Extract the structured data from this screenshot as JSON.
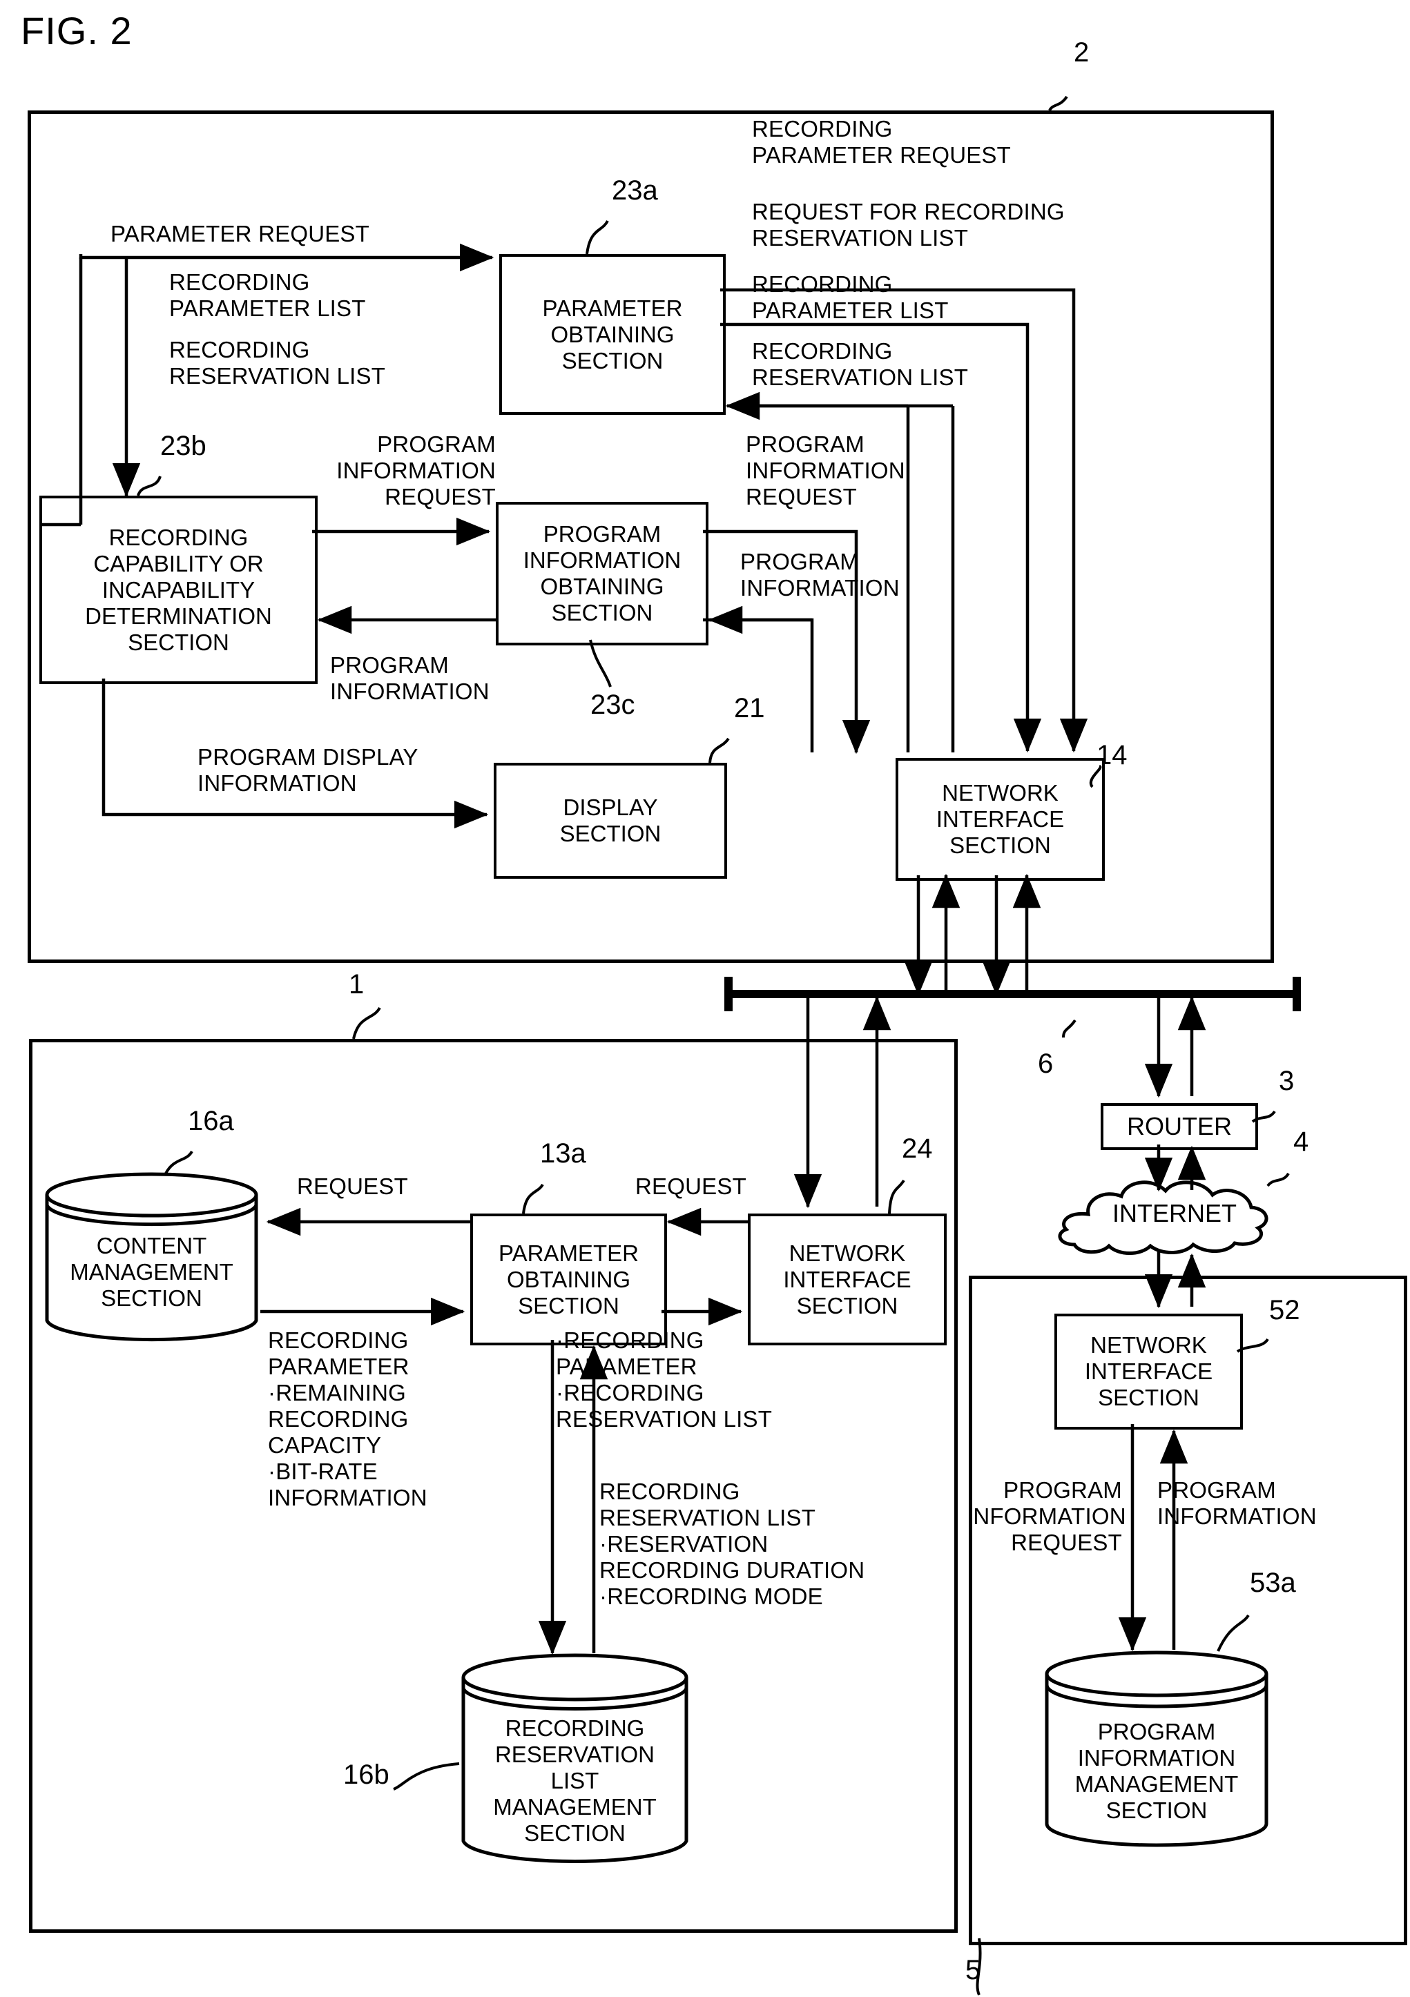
{
  "figure": {
    "title": "FIG. 2"
  },
  "refs": {
    "r2": "2",
    "r1": "1",
    "r6": "6",
    "r3": "3",
    "r4": "4",
    "r5": "5",
    "r14": "14",
    "r21": "21",
    "r23a": "23a",
    "r23b": "23b",
    "r23c": "23c",
    "r24": "24",
    "r13a": "13a",
    "r16a": "16a",
    "r16b": "16b",
    "r52": "52",
    "r53a": "53a"
  },
  "boxes": {
    "parameter_obtaining_top": "PARAMETER\nOBTAINING\nSECTION",
    "recording_capability": "RECORDING\nCAPABILITY OR\nINCAPABILITY\nDETERMINATION\nSECTION",
    "program_information_obtaining": "PROGRAM\nINFORMATION\nOBTAINING\nSECTION",
    "display_section": "DISPLAY\nSECTION",
    "network_interface_top": "NETWORK\nINTERFACE\nSECTION",
    "parameter_obtaining_bottom": "PARAMETER\nOBTAINING\nSECTION",
    "network_interface_bottom": "NETWORK\nINTERFACE\nSECTION",
    "router": "ROUTER",
    "internet": "INTERNET",
    "network_interface_server": "NETWORK\nINTERFACE\nSECTION"
  },
  "cylinders": {
    "content_management": "CONTENT\nMANAGEMENT\nSECTION",
    "recording_reservation_list_mgmt": "RECORDING\nRESERVATION\nLIST\nMANAGEMENT\nSECTION",
    "program_information_mgmt": "PROGRAM\nINFORMATION\nMANAGEMENT\nSECTION"
  },
  "edge_labels": {
    "parameter_request": "PARAMETER REQUEST",
    "recording_parameter_list_left": "RECORDING\nPARAMETER LIST",
    "recording_reservation_list_left": "RECORDING\nRESERVATION LIST",
    "recording_parameter_request_tr": "RECORDING\nPARAMETER REQUEST",
    "request_for_recording_reservation_list": "REQUEST FOR RECORDING\nRESERVATION LIST",
    "recording_parameter_list_right": "RECORDING\nPARAMETER LIST",
    "recording_reservation_list_right": "RECORDING\nRESERVATION LIST",
    "program_information_request_left": "PROGRAM\nINFORMATION\nREQUEST",
    "program_information_request_right": "PROGRAM\nINFORMATION\nREQUEST",
    "program_information_mid": "PROGRAM\nINFORMATION",
    "program_information_left": "PROGRAM\nINFORMATION",
    "program_display_information": "PROGRAM DISPLAY\nINFORMATION",
    "request_cm": "REQUEST",
    "request_nif": "REQUEST",
    "content_out_list": "RECORDING\nPARAMETER\n·REMAINING\nRECORDING\nCAPACITY\n·BIT-RATE\nINFORMATION",
    "param_up_list": "·RECORDING\nPARAMETER\n·RECORDING\nRESERVATION LIST",
    "param_down_list": "RECORDING\nRESERVATION LIST\n·RESERVATION\nRECORDING DURATION\n·RECORDING MODE",
    "program_information_request_server": "PROGRAM\nINFORMATION\nREQUEST",
    "program_information_server": "PROGRAM\nINFORMATION"
  }
}
